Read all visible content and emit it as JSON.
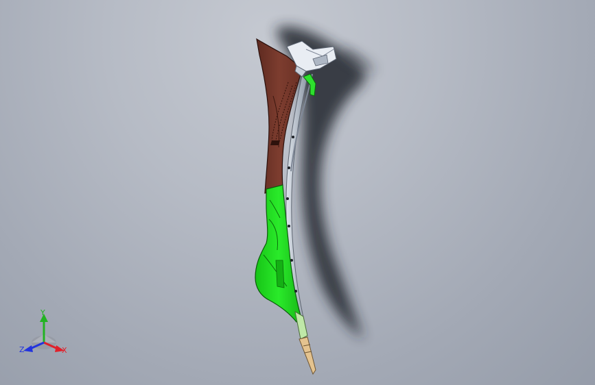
{
  "triad": {
    "x_label": "X",
    "y_label": "Y",
    "z_label": "Z",
    "x_color": "#e0202a",
    "y_color": "#22b322",
    "z_color": "#2233dd"
  },
  "model": {
    "colors": {
      "upper_panel": "#7a3a2c",
      "lower_panel": "#22dd22",
      "bracket": "#e8ecf2",
      "rail": "#b7c0cc",
      "tip": "#e8c896",
      "shadow": "#2a2d34"
    }
  }
}
